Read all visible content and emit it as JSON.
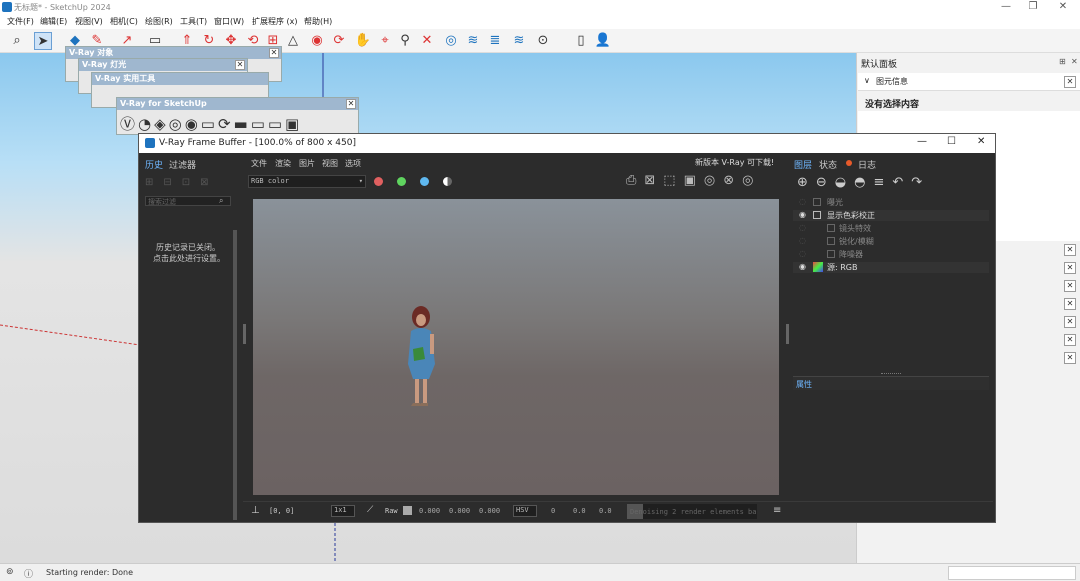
{
  "window": {
    "title": "无标题* - SketchUp 2024",
    "minimize": "—",
    "maximize": "❐",
    "close": "✕"
  },
  "menu": [
    "文件(F)",
    "编辑(E)",
    "视图(V)",
    "相机(C)",
    "绘图(R)",
    "工具(T)",
    "窗口(W)",
    "扩展程序 (x)",
    "帮助(H)"
  ],
  "toolbar_icons": [
    "search-icon",
    "select-icon",
    "eraser-icon",
    "paint-icon",
    "line-icon",
    "rectangle-icon",
    "pushpull-icon",
    "rotate-icon",
    "move-icon",
    "offset-icon",
    "tape-icon",
    "protractor-icon",
    "followme-icon",
    "orbit-icon",
    "pan-icon",
    "zoom-icon",
    "zoom-extents-icon",
    "section-icon",
    "sandbox-icon",
    "layers-icon",
    "styles-icon",
    "account-icon",
    "doc-icon",
    "person-icon"
  ],
  "vray_toolbars": {
    "objects": "V-Ray 对象",
    "lights": "V-Ray 灯光",
    "utilities": "V-Ray 实用工具",
    "main": "V-Ray for SketchUp"
  },
  "right_panel": {
    "title": "默认面板",
    "section": "图元信息",
    "empty_text": "没有选择内容"
  },
  "vfb": {
    "title": "V-Ray Frame Buffer - [100.0% of 800 x 450]",
    "left_tabs": [
      "历史",
      "过滤器"
    ],
    "search_placeholder": "搜索过滤",
    "history_msg_line1": "历史记录已关闭。",
    "history_msg_line2": "点击此处进行设置。",
    "menu": [
      "文件",
      "渲染",
      "图片",
      "视图",
      "选项"
    ],
    "update_notice": "新版本 V-Ray 可下载!",
    "channel": "RGB color",
    "right_tabs": [
      "图层",
      "状态",
      "日志"
    ],
    "layers": [
      {
        "name": "曝光",
        "visible": false,
        "indent": false
      },
      {
        "name": "显示色彩校正",
        "visible": true,
        "indent": false
      },
      {
        "name": "镜头特效",
        "visible": false,
        "indent": true
      },
      {
        "name": "锐化/模糊",
        "visible": false,
        "indent": true
      },
      {
        "name": "降噪器",
        "visible": false,
        "indent": true
      },
      {
        "name": "源: RGB",
        "visible": true,
        "indent": false
      }
    ],
    "properties_label": "属性",
    "coords": "[0, 0]",
    "zoom_sel": "1x1",
    "raw_label": "Raw",
    "raw_values": [
      "0.000",
      "0.000",
      "0.000"
    ],
    "color_space": "HSV",
    "hsv_values": [
      "0",
      "0.0",
      "0.0"
    ],
    "progress_text": "Denoising 2 render elements bas",
    "progress": 0.12
  },
  "status": {
    "text": "Starting render: Done"
  },
  "colors": {
    "accent": "#1e73be",
    "vfb_bg": "#2c2c2c",
    "sky_top": "#8bc8ee",
    "log_dot": "#e85a2a"
  }
}
